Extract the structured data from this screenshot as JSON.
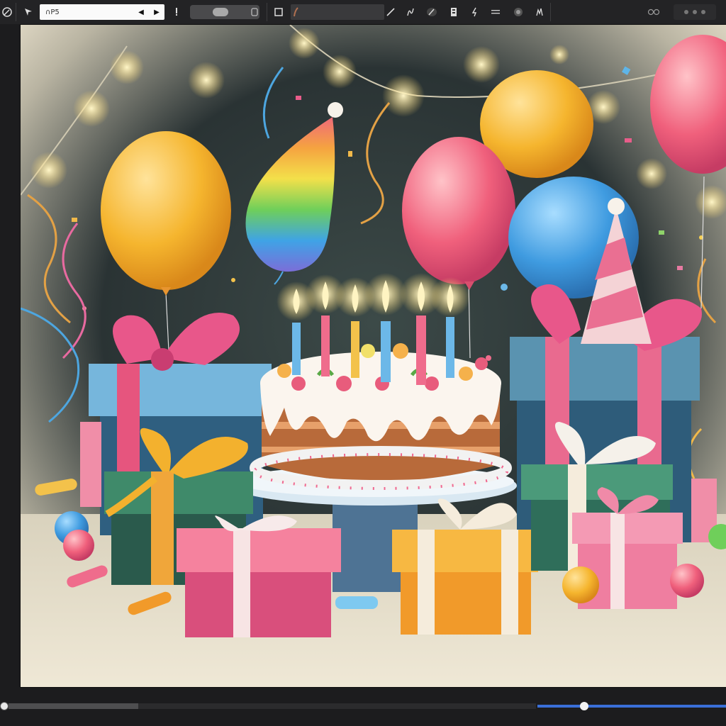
{
  "toolbar": {
    "document_name": "∩P5",
    "prev_label": "◀",
    "next_label": "▶",
    "icons": [
      "brush-icon",
      "move-icon",
      "pin-icon",
      "opacity-slider",
      "layer-icon",
      "frame-icon",
      "brush-preset",
      "pen-icon",
      "wave-icon",
      "eraser-icon",
      "smudge-icon",
      "select-icon",
      "lines-icon",
      "fill-icon",
      "lasso-icon",
      "view-icon",
      "grid-icon"
    ]
  },
  "colors": {
    "ui_bg": "#1c1c1e",
    "toolbar_bg": "#232325",
    "accent": "#3a6fd8",
    "balloon_yellow": "#f5b52e",
    "balloon_pink": "#f0607c",
    "balloon_blue": "#3f9be0"
  },
  "bottombar": {
    "zoom_level": 0.24
  }
}
